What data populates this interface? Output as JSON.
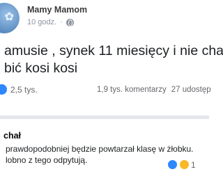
{
  "post": {
    "author": "Mamy Mamom",
    "time": "10 godz.",
    "text_lines": [
      "amusie , synek 11 miesięcy i nie cha",
      "bić kosi kosi"
    ],
    "reactions_count": "2,5 tys.",
    "comments_count": "1,9 tys. komentarzy",
    "shares_count": "27 udostęp"
  },
  "comment": {
    "author": "chał",
    "lines": [
      "prawdopodobniej będzie powtarzał klasę w żłobku.",
      "lobno z tego odpytują."
    ],
    "reactions_count": "1"
  },
  "icons": {
    "avatar": "profile-avatar",
    "audience": "globe-icon",
    "reaction": "like-reaction-icon"
  },
  "colors": {
    "meta_text": "#8d949e",
    "separator": "#e4e6eb",
    "like_blue": "#2d88ff"
  }
}
